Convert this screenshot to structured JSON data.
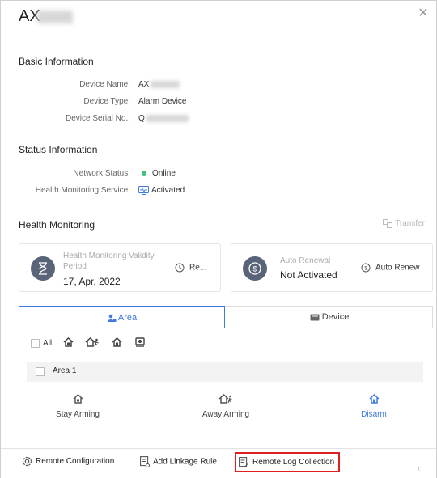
{
  "header": {
    "title_prefix": "AX",
    "close_icon": "close-icon"
  },
  "basic": {
    "title": "Basic Information",
    "device_name_label": "Device Name:",
    "device_name_value": "AX",
    "device_type_label": "Device Type:",
    "device_type_value": "Alarm Device",
    "serial_label": "Device Serial No.:",
    "serial_value": "Q"
  },
  "status": {
    "title": "Status Information",
    "network_label": "Network Status:",
    "network_value": "Online",
    "network_color": "#3cc07c",
    "health_label": "Health Monitoring Service:",
    "health_value": "Activated"
  },
  "health": {
    "title": "Health Monitoring",
    "transfer_label": "Transfer",
    "validity_label": "Health Monitoring Validity Period",
    "validity_value": "17, Apr, 2022",
    "renew_label": "Re...",
    "auto_renewal_label": "Auto Renewal",
    "auto_renewal_value": "Not Activated",
    "auto_renew_button": "Auto Renew"
  },
  "tabs": {
    "area": "Area",
    "device": "Device"
  },
  "toolbar": {
    "all_label": "All"
  },
  "area": {
    "name": "Area 1",
    "actions": [
      {
        "label": "Stay Arming",
        "color": "#444444",
        "icon": "stay-arm-icon"
      },
      {
        "label": "Away Arming",
        "color": "#444444",
        "icon": "away-arm-icon"
      },
      {
        "label": "Disarm",
        "color": "#3f7ae0",
        "icon": "disarm-icon"
      }
    ]
  },
  "footer": {
    "remote_config": "Remote Configuration",
    "add_linkage": "Add Linkage Rule",
    "remote_log": "Remote Log Collection",
    "more": "‹"
  },
  "colors": {
    "accent": "#3f7ae0",
    "highlight_border": "#e02020"
  }
}
